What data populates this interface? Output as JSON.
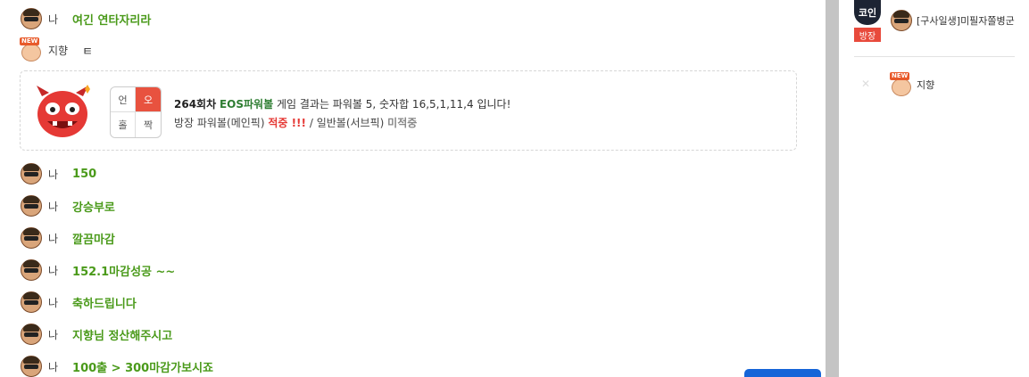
{
  "chat": {
    "me_label": "나",
    "messages_top": [
      {
        "user": "나",
        "text": "여긴 연타자리라"
      },
      {
        "user": "지향",
        "text": "ㅌ"
      }
    ],
    "result_card": {
      "grid": [
        "언",
        "오",
        "홀",
        "짝"
      ],
      "round": "264회차",
      "game": "EOS파워볼",
      "result_text": "게임 결과는 파워볼 5, 숫자합 16,5,1,11,4 입니다!",
      "pick_prefix": "방장 파워볼(메인픽)",
      "pick_result": "적중 !!!",
      "sep": "/",
      "sub_prefix": "일반볼(서브픽)",
      "sub_result": "미적중"
    },
    "messages_bottom": [
      {
        "user": "나",
        "text": "150"
      },
      {
        "user": "나",
        "text": "강승부로"
      },
      {
        "user": "나",
        "text": "깔끔마감"
      },
      {
        "user": "나",
        "text": "152.1마감성공 ~~"
      },
      {
        "user": "나",
        "text": "축하드립니다"
      },
      {
        "user": "나",
        "text": "지향님 정산해주시고"
      },
      {
        "user": "나",
        "text": "100출 > 300마감가보시죠"
      }
    ]
  },
  "sidebar": {
    "host_logo": "코인",
    "host_badge": "방장",
    "host_user": "[구사일생]미필자쫄병군",
    "member_user": "지향",
    "new_tag": "NEW"
  },
  "icons": {
    "me_avatar": "face-me-icon",
    "new_avatar": "face-new-icon",
    "mute": "mute-icon"
  }
}
